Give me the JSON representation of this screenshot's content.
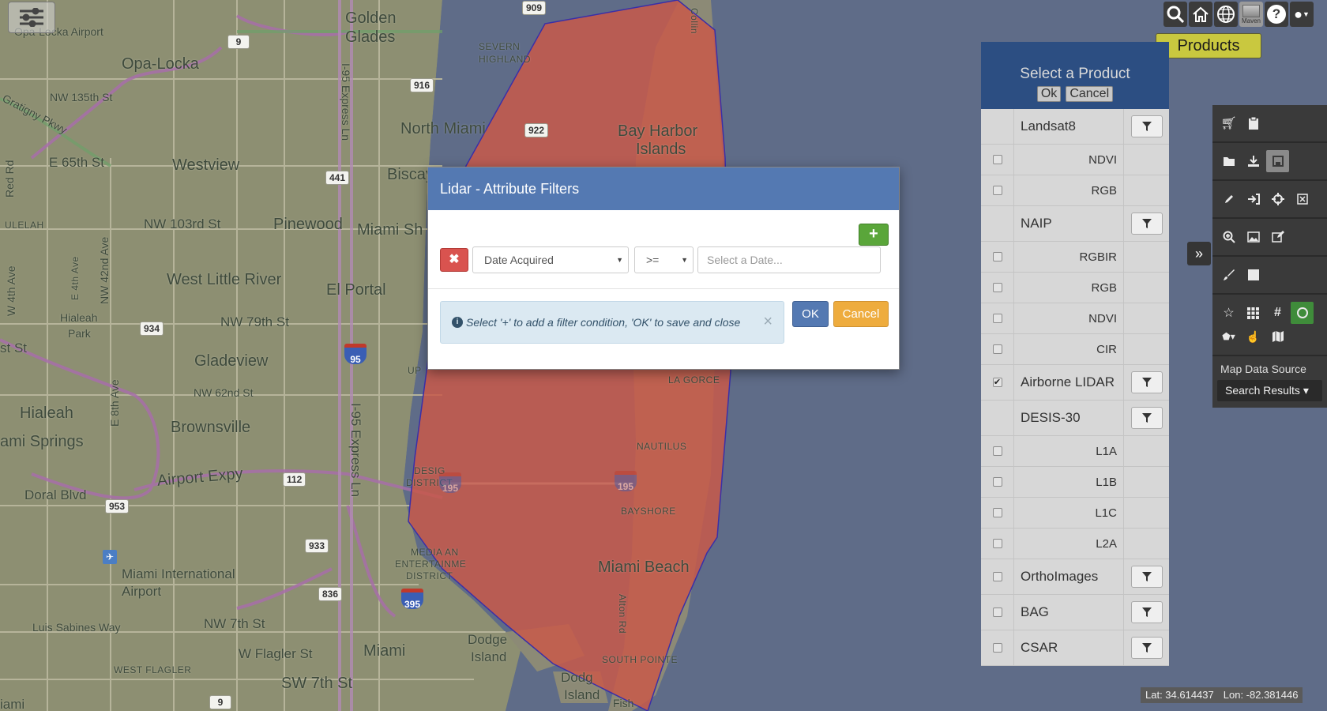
{
  "map": {
    "labels": {
      "opa_locka_airport": "Opa-Locka Airport",
      "golden_glades": "Golden",
      "golden_glades2": "Glades",
      "opa_locka": "Opa-Locka",
      "severn_highland": "SEVERN",
      "severn_highland2": "HIGHLAND",
      "nw_135th": "NW 135th St",
      "north_miami": "North Miami",
      "bay_harbor": "Bay Harbor",
      "bay_harbor2": "Islands",
      "gratigny": "Gratigny Pkwy",
      "e_65th": "E 65th St",
      "westview": "Westview",
      "biscayne": "Biscay",
      "ulelah": "ULELAH",
      "nw_103rd": "NW 103rd St",
      "pinewood": "Pinewood",
      "miami_shores": "Miami Sh",
      "west_little_river": "West Little River",
      "el_portal": "El Portal",
      "hialeah_park": "Hialeah",
      "hialeah_park2": "Park",
      "nw_79th": "NW 79th St",
      "st_dst": "st St",
      "gladeview": "Gladeview",
      "nw_62nd": "NW 62nd St",
      "hialeah": "Hialeah",
      "brownsville": "Brownsville",
      "miami_springs": "ami Springs",
      "airport_expy": "Airport Expy",
      "doral_blvd": "Doral Blvd",
      "design_district": "DESIG",
      "design_district2": "DISTRICT",
      "nautilus": "NAUTILUS",
      "bayshore": "BAYSHORE",
      "mia": "Miami International",
      "mia2": "Airport",
      "media_ent": "MEDIA AN",
      "media_ent2": "ENTERTAINME",
      "media_ent3": "DISTRICT",
      "miami_beach": "Miami Beach",
      "luis_sabines": "Luis Sabines Way",
      "nw_7th": "NW 7th St",
      "miami": "Miami",
      "w_flagler_st": "W Flagler St",
      "w_flagler": "WEST FLAGLER",
      "sw_7th": "SW 7th St",
      "dodge_island": "Dodge",
      "dodge_island2": "Island",
      "dodge2": "Dodg",
      "dodge2b": "Island",
      "fisher": "Fish",
      "south_pointe": "SOUTH POINTE",
      "alton_rd": "Alton Rd",
      "collins": "Collin",
      "la_gorce": "LA GORCE",
      "upper": "UP",
      "miami_bottom": "iami",
      "red_rd": "Red Rd",
      "w_4th_ave": "W 4th Ave",
      "e_4th_ave": "E 4th Ave",
      "nw_42nd_ave": "NW 42nd Ave",
      "e_8th_ave": "E 8th Ave",
      "i95_express": "I-95 Express Ln",
      "i95_express2": "I-95 Express Ln"
    },
    "shields": [
      "909",
      "9",
      "916",
      "922",
      "441",
      "934",
      "112",
      "953",
      "933",
      "836",
      "9"
    ],
    "interstates": [
      "95",
      "395",
      "195",
      "195",
      "195"
    ],
    "polygon_fill": "#c8594a",
    "polygon_stroke": "#3a2fa8"
  },
  "toolbar": {
    "icons": [
      "search-icon",
      "home-icon",
      "globe-icon",
      "basemap-icon",
      "help-icon",
      "user-icon"
    ],
    "basemap_label": "Maven",
    "products_label": "Products"
  },
  "product_panel": {
    "title": "Select a Product",
    "ok_label": "Ok",
    "cancel_label": "Cancel",
    "items": [
      {
        "name": "Landsat8",
        "type": "parent",
        "checked": false,
        "has_filter": true,
        "has_checkbox": false
      },
      {
        "name": "NDVI",
        "type": "child",
        "checked": false
      },
      {
        "name": "RGB",
        "type": "child",
        "checked": false
      },
      {
        "name": "NAIP",
        "type": "parent",
        "checked": false,
        "has_filter": true,
        "has_checkbox": false
      },
      {
        "name": "RGBIR",
        "type": "child",
        "checked": false
      },
      {
        "name": "RGB",
        "type": "child",
        "checked": false
      },
      {
        "name": "NDVI",
        "type": "child",
        "checked": false
      },
      {
        "name": "CIR",
        "type": "child",
        "checked": false
      },
      {
        "name": "Airborne LIDAR",
        "type": "parent",
        "checked": true,
        "has_filter": true,
        "has_checkbox": true
      },
      {
        "name": "DESIS-30",
        "type": "parent",
        "checked": false,
        "has_filter": true,
        "has_checkbox": false
      },
      {
        "name": "L1A",
        "type": "child",
        "checked": false
      },
      {
        "name": "L1B",
        "type": "child",
        "checked": false
      },
      {
        "name": "L1C",
        "type": "child",
        "checked": false
      },
      {
        "name": "L2A",
        "type": "child",
        "checked": false
      },
      {
        "name": "OrthoImages",
        "type": "parent",
        "checked": false,
        "has_filter": true,
        "has_checkbox": true
      },
      {
        "name": "BAG",
        "type": "parent",
        "checked": false,
        "has_filter": true,
        "has_checkbox": true
      },
      {
        "name": "CSAR",
        "type": "parent",
        "checked": false,
        "has_filter": true,
        "has_checkbox": true
      }
    ]
  },
  "tool_sidebar": {
    "toggle_icon": "»",
    "map_source_label": "Map Data Source",
    "map_source_value": "Search Results ▾"
  },
  "coords": {
    "lat": "Lat: 34.614437",
    "lon": "Lon: -82.381446"
  },
  "modal": {
    "title": "Lidar - Attribute Filters",
    "add_label": "+",
    "remove_label": "✖",
    "attribute_value": "Date Acquired",
    "operator_value": ">=",
    "date_placeholder": "Select a Date...",
    "info_text": "Select '+' to add a filter condition, 'OK' to save and close",
    "info_close": "×",
    "ok_label": "OK",
    "cancel_label": "Cancel"
  }
}
